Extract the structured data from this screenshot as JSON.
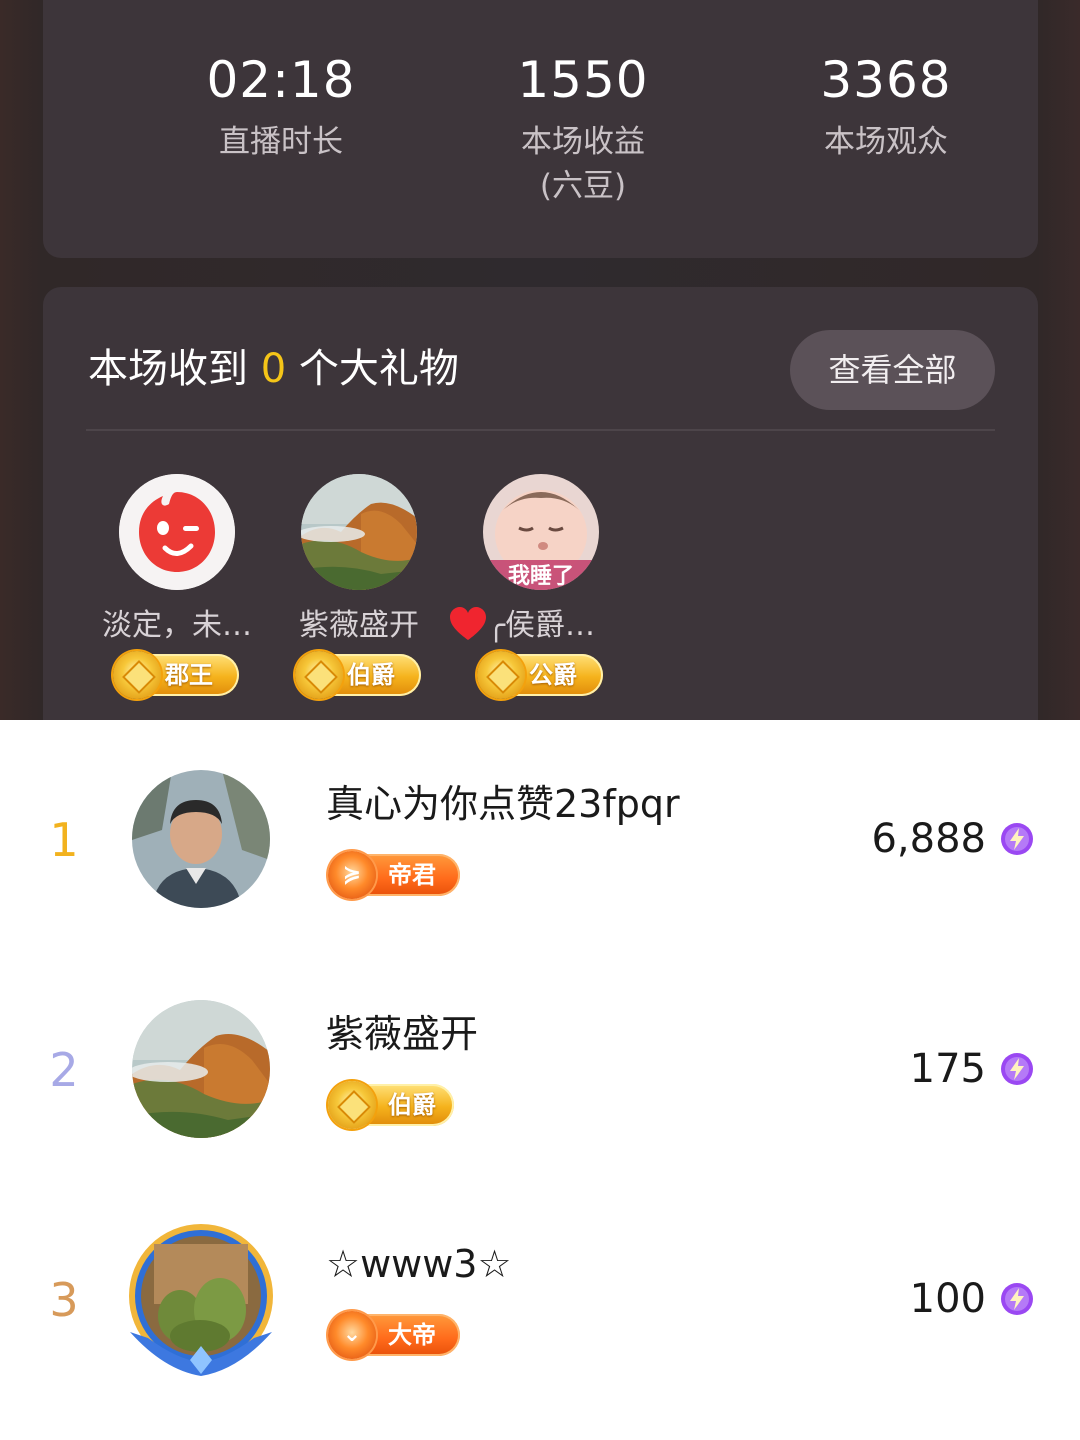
{
  "stats": {
    "duration": {
      "value": "02:18",
      "label": "直播时长"
    },
    "income": {
      "value": "1550",
      "label": "本场收益",
      "unit": "(六豆)"
    },
    "viewers": {
      "value": "3368",
      "label": "本场观众"
    }
  },
  "gifts": {
    "title_prefix": "本场收到",
    "count": "0",
    "title_suffix": "个大礼物",
    "view_all_label": "查看全部",
    "gifters": [
      {
        "name": "淡定，未…",
        "badge": "郡王",
        "avatar": "red-mascot-avatar"
      },
      {
        "name": "紫薇盛开",
        "badge": "伯爵",
        "avatar": "mountain-landscape-avatar"
      },
      {
        "name": "╭侯爵…",
        "badge": "公爵",
        "avatar": "sleeping-baby-avatar",
        "avatar_text": "我睡了"
      }
    ]
  },
  "ranking": [
    {
      "rank": "1",
      "name": "真心为你点赞23fpqr",
      "badge": "帝君",
      "badge_style": "orange",
      "value": "6,888",
      "rank_color": "#f2b21e"
    },
    {
      "rank": "2",
      "name": "紫薇盛开",
      "badge": "伯爵",
      "badge_style": "gold",
      "value": "175",
      "rank_color": "#a7a9e6"
    },
    {
      "rank": "3",
      "name": "☆www3☆",
      "badge": "大帝",
      "badge_style": "orange",
      "value": "100",
      "rank_color": "#d79a5a"
    }
  ],
  "colors": {
    "accent_count": "#f5c518",
    "card_bg": "#3d353a",
    "bean_icon": "#8a3cf0"
  }
}
